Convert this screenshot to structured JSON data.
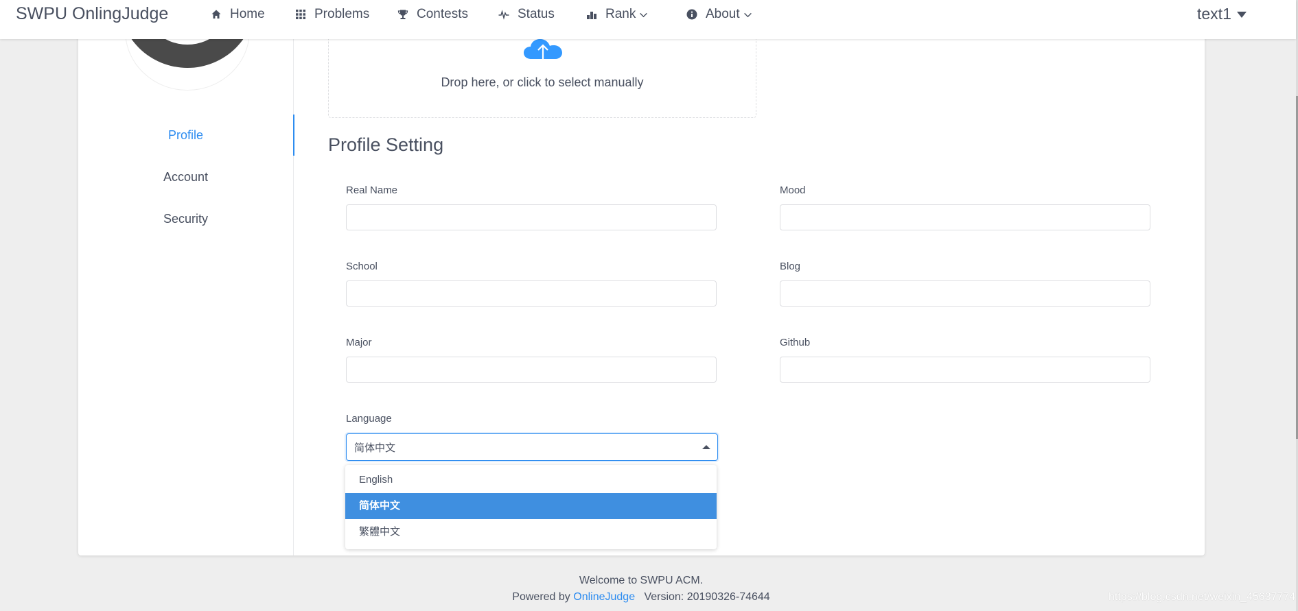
{
  "header": {
    "logo": "SWPU OnlingJudge",
    "nav": {
      "home": "Home",
      "problems": "Problems",
      "contests": "Contests",
      "status": "Status",
      "rank": "Rank",
      "about": "About"
    },
    "username": "text1"
  },
  "sidebar": {
    "items": [
      {
        "label": "Profile",
        "active": true
      },
      {
        "label": "Account",
        "active": false
      },
      {
        "label": "Security",
        "active": false
      }
    ]
  },
  "upload": {
    "text": "Drop here, or click to select manually"
  },
  "profile": {
    "title": "Profile Setting",
    "fields": {
      "real_name": {
        "label": "Real Name",
        "value": ""
      },
      "mood": {
        "label": "Mood",
        "value": ""
      },
      "school": {
        "label": "School",
        "value": ""
      },
      "blog": {
        "label": "Blog",
        "value": ""
      },
      "major": {
        "label": "Major",
        "value": ""
      },
      "github": {
        "label": "Github",
        "value": ""
      }
    },
    "language": {
      "label": "Language",
      "selected": "简体中文",
      "options": [
        "English",
        "简体中文",
        "繁體中文"
      ]
    }
  },
  "footer": {
    "welcome": "Welcome to SWPU ACM.",
    "powered_by": "Powered by",
    "link": "OnlineJudge",
    "version": "Version: 20190326-74644"
  },
  "watermark": "https://blog.csdn.net/weixin_45637774",
  "colors": {
    "accent": "#2d8cf0",
    "selected_option": "#3f8fe0",
    "text": "#495060",
    "background": "#eeeeee"
  },
  "icons": [
    "home-icon",
    "grid-icon",
    "trophy-icon",
    "pulse-icon",
    "bar-chart-icon",
    "info-icon",
    "chevron-down-icon",
    "caret-down-icon",
    "cloud-upload-icon"
  ]
}
